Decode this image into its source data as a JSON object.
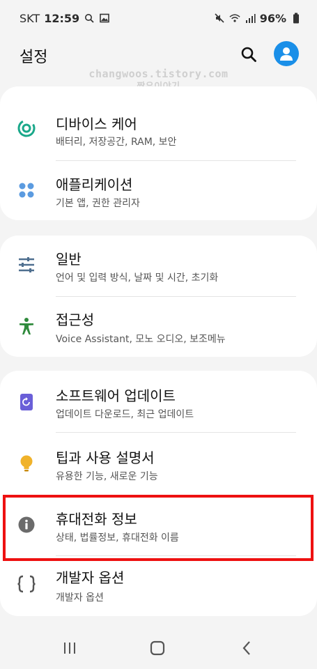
{
  "status_bar": {
    "carrier": "SKT",
    "time": "12:59",
    "battery": "96%",
    "icons": [
      "search-icon",
      "image-icon",
      "mute-icon",
      "wifi-icon",
      "signal-icon",
      "battery-icon"
    ]
  },
  "header": {
    "title": "설정",
    "search_icon": "search-icon",
    "avatar_icon": "account-icon"
  },
  "watermark": {
    "line1": "changwoos.tistory.com",
    "line2": "짱우이야기"
  },
  "groups": [
    {
      "items": [
        {
          "title": "디바이스 케어",
          "subtitle": "배터리, 저장공간, RAM, 보안",
          "icon": "device-care-icon",
          "icon_color": "#1aa88a"
        },
        {
          "title": "애플리케이션",
          "subtitle": "기본 앱, 권한 관리자",
          "icon": "apps-grid-icon",
          "icon_color": "#5b9be0"
        }
      ]
    },
    {
      "items": [
        {
          "title": "일반",
          "subtitle": "언어 및 입력 방식, 날짜 및 시간, 초기화",
          "icon": "sliders-icon",
          "icon_color": "#4f6f8f"
        },
        {
          "title": "접근성",
          "subtitle": "Voice Assistant, 모노 오디오, 보조메뉴",
          "icon": "accessibility-icon",
          "icon_color": "#2f8a3c"
        }
      ]
    },
    {
      "items": [
        {
          "title": "소프트웨어 업데이트",
          "subtitle": "업데이트 다운로드, 최근 업데이트",
          "icon": "software-update-icon",
          "icon_color": "#6a5fd8"
        },
        {
          "title": "팁과 사용 설명서",
          "subtitle": "유용한 기능, 새로운 기능",
          "icon": "lightbulb-icon",
          "icon_color": "#f0b22a"
        },
        {
          "title": "휴대전화 정보",
          "subtitle": "상태, 법률정보, 휴대전화 이름",
          "icon": "info-icon",
          "icon_color": "#6b6b6b"
        },
        {
          "title": "개발자 옵션",
          "subtitle": "개발자 옵션",
          "icon": "braces-icon",
          "icon_color": "#555555"
        }
      ]
    }
  ],
  "navbar": {
    "recent_icon": "recent-apps-icon",
    "home_icon": "home-icon",
    "back_icon": "back-icon"
  },
  "colors": {
    "highlight": "#ee1111",
    "background": "#f4f4f4",
    "accent": "#1a8fe8"
  }
}
